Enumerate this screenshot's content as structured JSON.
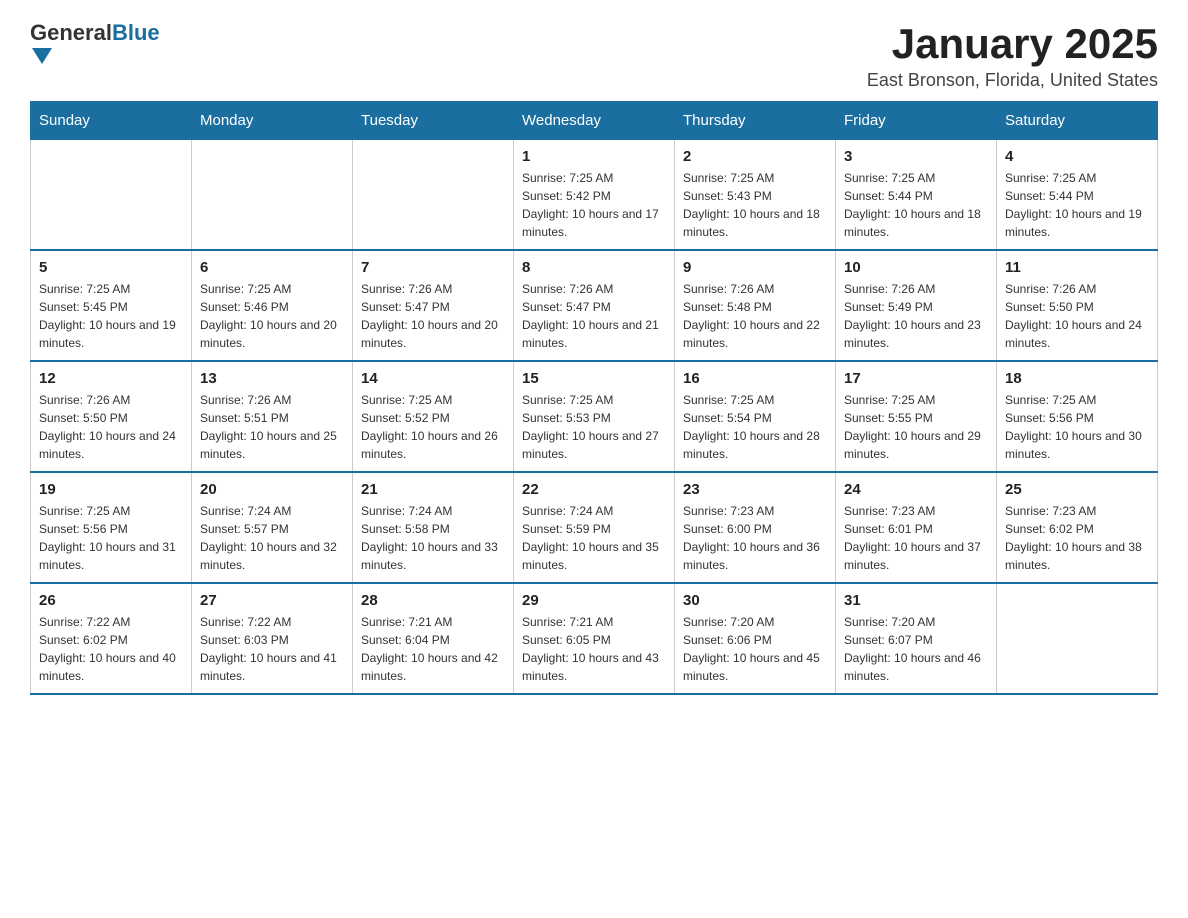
{
  "header": {
    "logo_general": "General",
    "logo_blue": "Blue",
    "month_title": "January 2025",
    "location": "East Bronson, Florida, United States"
  },
  "days_of_week": [
    "Sunday",
    "Monday",
    "Tuesday",
    "Wednesday",
    "Thursday",
    "Friday",
    "Saturday"
  ],
  "weeks": [
    [
      {
        "day": "",
        "info": ""
      },
      {
        "day": "",
        "info": ""
      },
      {
        "day": "",
        "info": ""
      },
      {
        "day": "1",
        "info": "Sunrise: 7:25 AM\nSunset: 5:42 PM\nDaylight: 10 hours and 17 minutes."
      },
      {
        "day": "2",
        "info": "Sunrise: 7:25 AM\nSunset: 5:43 PM\nDaylight: 10 hours and 18 minutes."
      },
      {
        "day": "3",
        "info": "Sunrise: 7:25 AM\nSunset: 5:44 PM\nDaylight: 10 hours and 18 minutes."
      },
      {
        "day": "4",
        "info": "Sunrise: 7:25 AM\nSunset: 5:44 PM\nDaylight: 10 hours and 19 minutes."
      }
    ],
    [
      {
        "day": "5",
        "info": "Sunrise: 7:25 AM\nSunset: 5:45 PM\nDaylight: 10 hours and 19 minutes."
      },
      {
        "day": "6",
        "info": "Sunrise: 7:25 AM\nSunset: 5:46 PM\nDaylight: 10 hours and 20 minutes."
      },
      {
        "day": "7",
        "info": "Sunrise: 7:26 AM\nSunset: 5:47 PM\nDaylight: 10 hours and 20 minutes."
      },
      {
        "day": "8",
        "info": "Sunrise: 7:26 AM\nSunset: 5:47 PM\nDaylight: 10 hours and 21 minutes."
      },
      {
        "day": "9",
        "info": "Sunrise: 7:26 AM\nSunset: 5:48 PM\nDaylight: 10 hours and 22 minutes."
      },
      {
        "day": "10",
        "info": "Sunrise: 7:26 AM\nSunset: 5:49 PM\nDaylight: 10 hours and 23 minutes."
      },
      {
        "day": "11",
        "info": "Sunrise: 7:26 AM\nSunset: 5:50 PM\nDaylight: 10 hours and 24 minutes."
      }
    ],
    [
      {
        "day": "12",
        "info": "Sunrise: 7:26 AM\nSunset: 5:50 PM\nDaylight: 10 hours and 24 minutes."
      },
      {
        "day": "13",
        "info": "Sunrise: 7:26 AM\nSunset: 5:51 PM\nDaylight: 10 hours and 25 minutes."
      },
      {
        "day": "14",
        "info": "Sunrise: 7:25 AM\nSunset: 5:52 PM\nDaylight: 10 hours and 26 minutes."
      },
      {
        "day": "15",
        "info": "Sunrise: 7:25 AM\nSunset: 5:53 PM\nDaylight: 10 hours and 27 minutes."
      },
      {
        "day": "16",
        "info": "Sunrise: 7:25 AM\nSunset: 5:54 PM\nDaylight: 10 hours and 28 minutes."
      },
      {
        "day": "17",
        "info": "Sunrise: 7:25 AM\nSunset: 5:55 PM\nDaylight: 10 hours and 29 minutes."
      },
      {
        "day": "18",
        "info": "Sunrise: 7:25 AM\nSunset: 5:56 PM\nDaylight: 10 hours and 30 minutes."
      }
    ],
    [
      {
        "day": "19",
        "info": "Sunrise: 7:25 AM\nSunset: 5:56 PM\nDaylight: 10 hours and 31 minutes."
      },
      {
        "day": "20",
        "info": "Sunrise: 7:24 AM\nSunset: 5:57 PM\nDaylight: 10 hours and 32 minutes."
      },
      {
        "day": "21",
        "info": "Sunrise: 7:24 AM\nSunset: 5:58 PM\nDaylight: 10 hours and 33 minutes."
      },
      {
        "day": "22",
        "info": "Sunrise: 7:24 AM\nSunset: 5:59 PM\nDaylight: 10 hours and 35 minutes."
      },
      {
        "day": "23",
        "info": "Sunrise: 7:23 AM\nSunset: 6:00 PM\nDaylight: 10 hours and 36 minutes."
      },
      {
        "day": "24",
        "info": "Sunrise: 7:23 AM\nSunset: 6:01 PM\nDaylight: 10 hours and 37 minutes."
      },
      {
        "day": "25",
        "info": "Sunrise: 7:23 AM\nSunset: 6:02 PM\nDaylight: 10 hours and 38 minutes."
      }
    ],
    [
      {
        "day": "26",
        "info": "Sunrise: 7:22 AM\nSunset: 6:02 PM\nDaylight: 10 hours and 40 minutes."
      },
      {
        "day": "27",
        "info": "Sunrise: 7:22 AM\nSunset: 6:03 PM\nDaylight: 10 hours and 41 minutes."
      },
      {
        "day": "28",
        "info": "Sunrise: 7:21 AM\nSunset: 6:04 PM\nDaylight: 10 hours and 42 minutes."
      },
      {
        "day": "29",
        "info": "Sunrise: 7:21 AM\nSunset: 6:05 PM\nDaylight: 10 hours and 43 minutes."
      },
      {
        "day": "30",
        "info": "Sunrise: 7:20 AM\nSunset: 6:06 PM\nDaylight: 10 hours and 45 minutes."
      },
      {
        "day": "31",
        "info": "Sunrise: 7:20 AM\nSunset: 6:07 PM\nDaylight: 10 hours and 46 minutes."
      },
      {
        "day": "",
        "info": ""
      }
    ]
  ]
}
